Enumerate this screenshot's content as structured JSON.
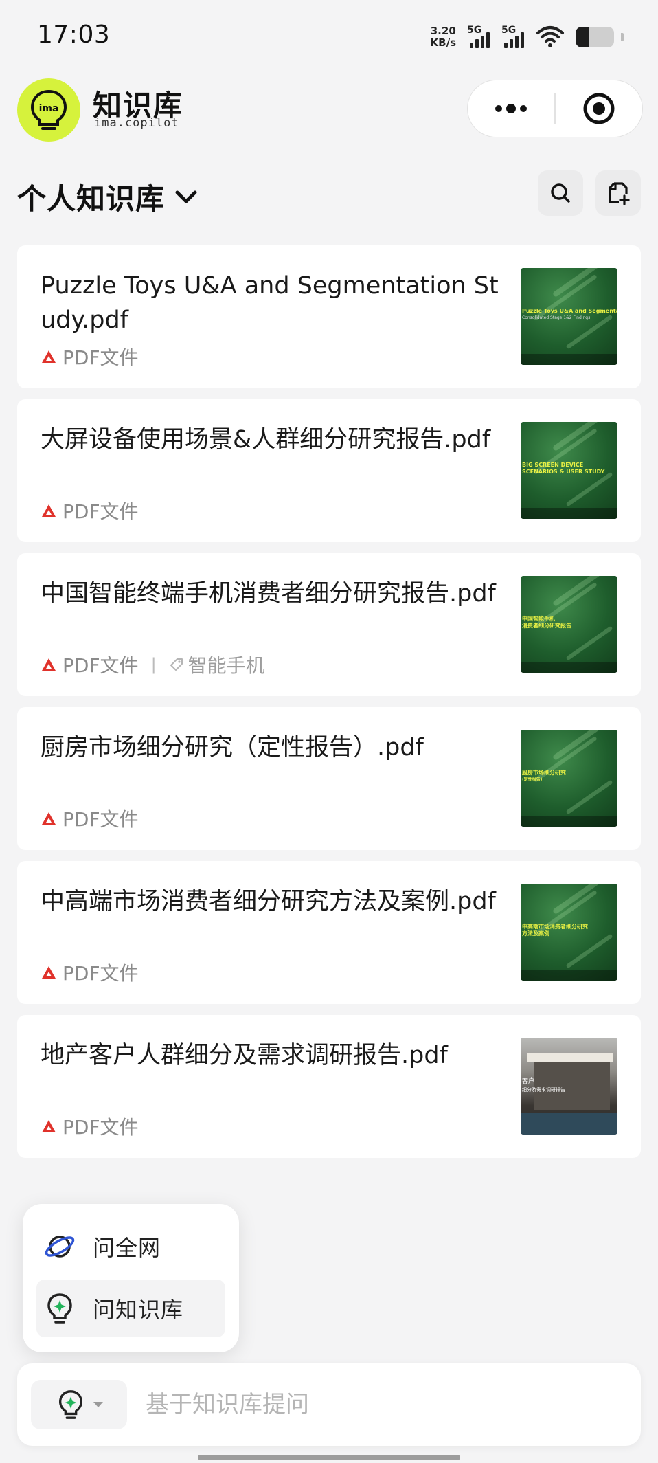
{
  "status_bar": {
    "time": "17:03",
    "net_speed_value": "3.20",
    "net_speed_unit": "KB/s",
    "sim1_label": "5G",
    "sim2_label": "5G",
    "battery_level": 0.34
  },
  "header": {
    "app_title": "知识库",
    "app_subtitle": "ima.copilot",
    "logo_text": "ima",
    "logo_color": "#d6f23c",
    "menu_icon": "more-dots-icon",
    "close_icon": "target-circle-icon"
  },
  "section": {
    "title": "个人知识库",
    "dropdown_icon": "chevron-down-icon",
    "search_icon": "search-icon",
    "add_icon": "add-document-icon"
  },
  "documents": [
    {
      "title": "Puzzle Toys U&A and Segmentation Study.pdf",
      "type": "PDF文件",
      "tag": "",
      "thumb_text_1": "Puzzle Toys U&A and Segmentation Study",
      "thumb_text_2": "Consolidated Stage 1&2 Findings"
    },
    {
      "title": "大屏设备使用场景&人群细分研究报告.pdf",
      "type": "PDF文件",
      "tag": "",
      "thumb_text_1": "BIG SCREEN DEVICE",
      "thumb_text_2": "SCENARIOS & USER STUDY"
    },
    {
      "title": "中国智能终端手机消费者细分研究报告.pdf",
      "type": "PDF文件",
      "tag": "智能手机",
      "thumb_text_1": "中国智能手机",
      "thumb_text_2": "消费者细分研究报告"
    },
    {
      "title": "厨房市场细分研究（定性报告）.pdf",
      "type": "PDF文件",
      "tag": "",
      "thumb_text_1": "厨房市场细分研究",
      "thumb_text_2": "(定性报告)"
    },
    {
      "title": "中高端市场消费者细分研究方法及案例.pdf",
      "type": "PDF文件",
      "tag": "",
      "thumb_text_1": "中高端市场消费者细分研究",
      "thumb_text_2": "方法及案例"
    },
    {
      "title": "地产客户人群细分及需求调研报告.pdf",
      "type": "PDF文件",
      "tag": "",
      "thumb_text_1": "客户",
      "thumb_text_2": "细分及需求调研报告"
    }
  ],
  "popup_menu": {
    "items": [
      {
        "label": "问全网",
        "icon": "planet-icon",
        "selected": false
      },
      {
        "label": "问知识库",
        "icon": "lightbulb-star-icon",
        "selected": true
      }
    ]
  },
  "input_bar": {
    "mode_icon": "lightbulb-star-icon",
    "placeholder": "基于知识库提问",
    "value": ""
  },
  "colors": {
    "accent_lime": "#d6f23c",
    "pdf_red": "#e0322b",
    "ask_green": "#22b35a",
    "planet_blue": "#2f55d4"
  }
}
